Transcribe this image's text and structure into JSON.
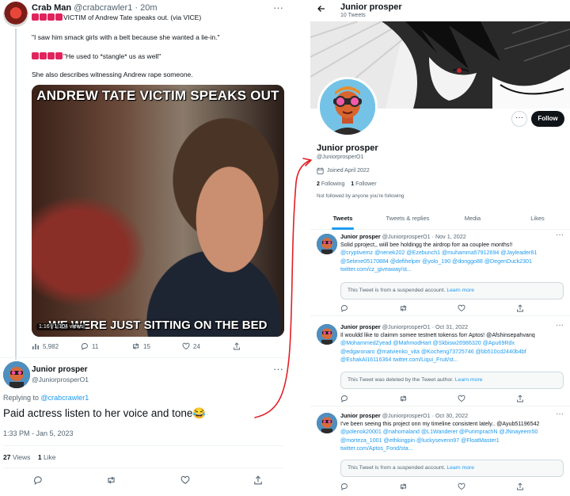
{
  "left": {
    "crab": {
      "name": "Crab Man",
      "handle": "@crabcrawler1",
      "time": "· 20m",
      "line1": "VICTIM of Andrew Tate speaks out. (via VICE)",
      "line2": "\"I saw him smack girls with a belt because she wanted a lie-in.\"",
      "line3": "\"He used to *stangle* us as well\"",
      "line4": "She also describes witnessing Andrew rape someone.",
      "video_title": "ANDREW TATE VICTIM SPEAKS OUT",
      "video_caption": "WE WERE JUST SITTING ON THE BED",
      "video_time": "1:16 | 1,104 views",
      "views": "5,982",
      "replies": "11",
      "retweets": "15",
      "likes": "24"
    },
    "reply": {
      "name": "Junior prosper",
      "handle": "@JuniorprosperO1",
      "replying_prefix": "Replying to",
      "replying_handle": "@crabcrawler1",
      "text": "Paid actress listen to her voice and tone😂",
      "timestamp": "1:33 PM - Jan 5, 2023",
      "views_count": "27",
      "views_label": "Views",
      "likes_count": "1",
      "likes_label": "Like"
    }
  },
  "right": {
    "header": {
      "title": "Junior prosper",
      "tweet_count": "10 Tweets"
    },
    "profile": {
      "name": "Junior prosper",
      "handle": "@JuniorprosperO1",
      "joined": "Joined April 2022",
      "following_count": "2",
      "following_label": "Following",
      "followers_count": "1",
      "followers_label": "Follower",
      "not_followed": "Not followed by anyone you're following",
      "more_label": "···",
      "follow_label": "Follow"
    },
    "tabs": [
      "Tweets",
      "Tweets & replies",
      "Media",
      "Likes"
    ],
    "tweets": [
      {
        "name": "Junior prosper",
        "handle": "@JuniorprosperO1",
        "date": "· Nov 1, 2022",
        "lines": [
          "Solid pproject,, wiill bee holdingg the airdrop forr aa couplee months!!",
          "@cryptivemz @nenek202 @Ezebunch1 @muhamma57912694 @Jayleader81",
          "@Selene05170884 @defihelper @yolo_190 @donggo88 @DegenDuck2301",
          "twitter.com/cz_giveaway/st..."
        ],
        "notice": "This Tweet is from a suspended account.",
        "notice_link": "Learn more"
      },
      {
        "name": "Junior prosper",
        "handle": "@JuniorprosperO1",
        "date": "· Oct 31, 2022",
        "lines": [
          "Il wouldd like to claimm somee  testnett tokenss forr Aptos! @Afshinsepahvanq",
          "@MohammedZyead @MahmodHart @Skbisw26986320 @Apu69Rdx",
          "@edgaronaro @matvienko_vita @Kocheng73725746 @bb510cd2440b4bf",
          "@EshakAl16116364 twitter.com/Liqui_Fruit/st..."
        ],
        "notice": "This Tweet was deleted by the Tweet author.",
        "notice_link": "Learn more"
      },
      {
        "name": "Junior prosper",
        "handle": "@JuniorprosperO1",
        "date": "· Oct 30, 2022",
        "lines": [
          "I've been seeing this project onn my timeline consistent lately.. @Ayub51196542",
          "@polenok20001 @nahomaland @L1Wanderer @PurimprachN @JNnayeem50",
          "@morteza_1001 @ethkingpin @luckysevenn97 @FloatMaster1",
          "twitter.com/Aptos_Fond/sta..."
        ],
        "notice": "This Tweet is from a suspended account.",
        "notice_link": "Learn more"
      }
    ]
  },
  "colors": {
    "accent": "#1d9bf0",
    "text": "#0f1419",
    "muted": "#536471",
    "annotation_red": "#e21f26"
  }
}
